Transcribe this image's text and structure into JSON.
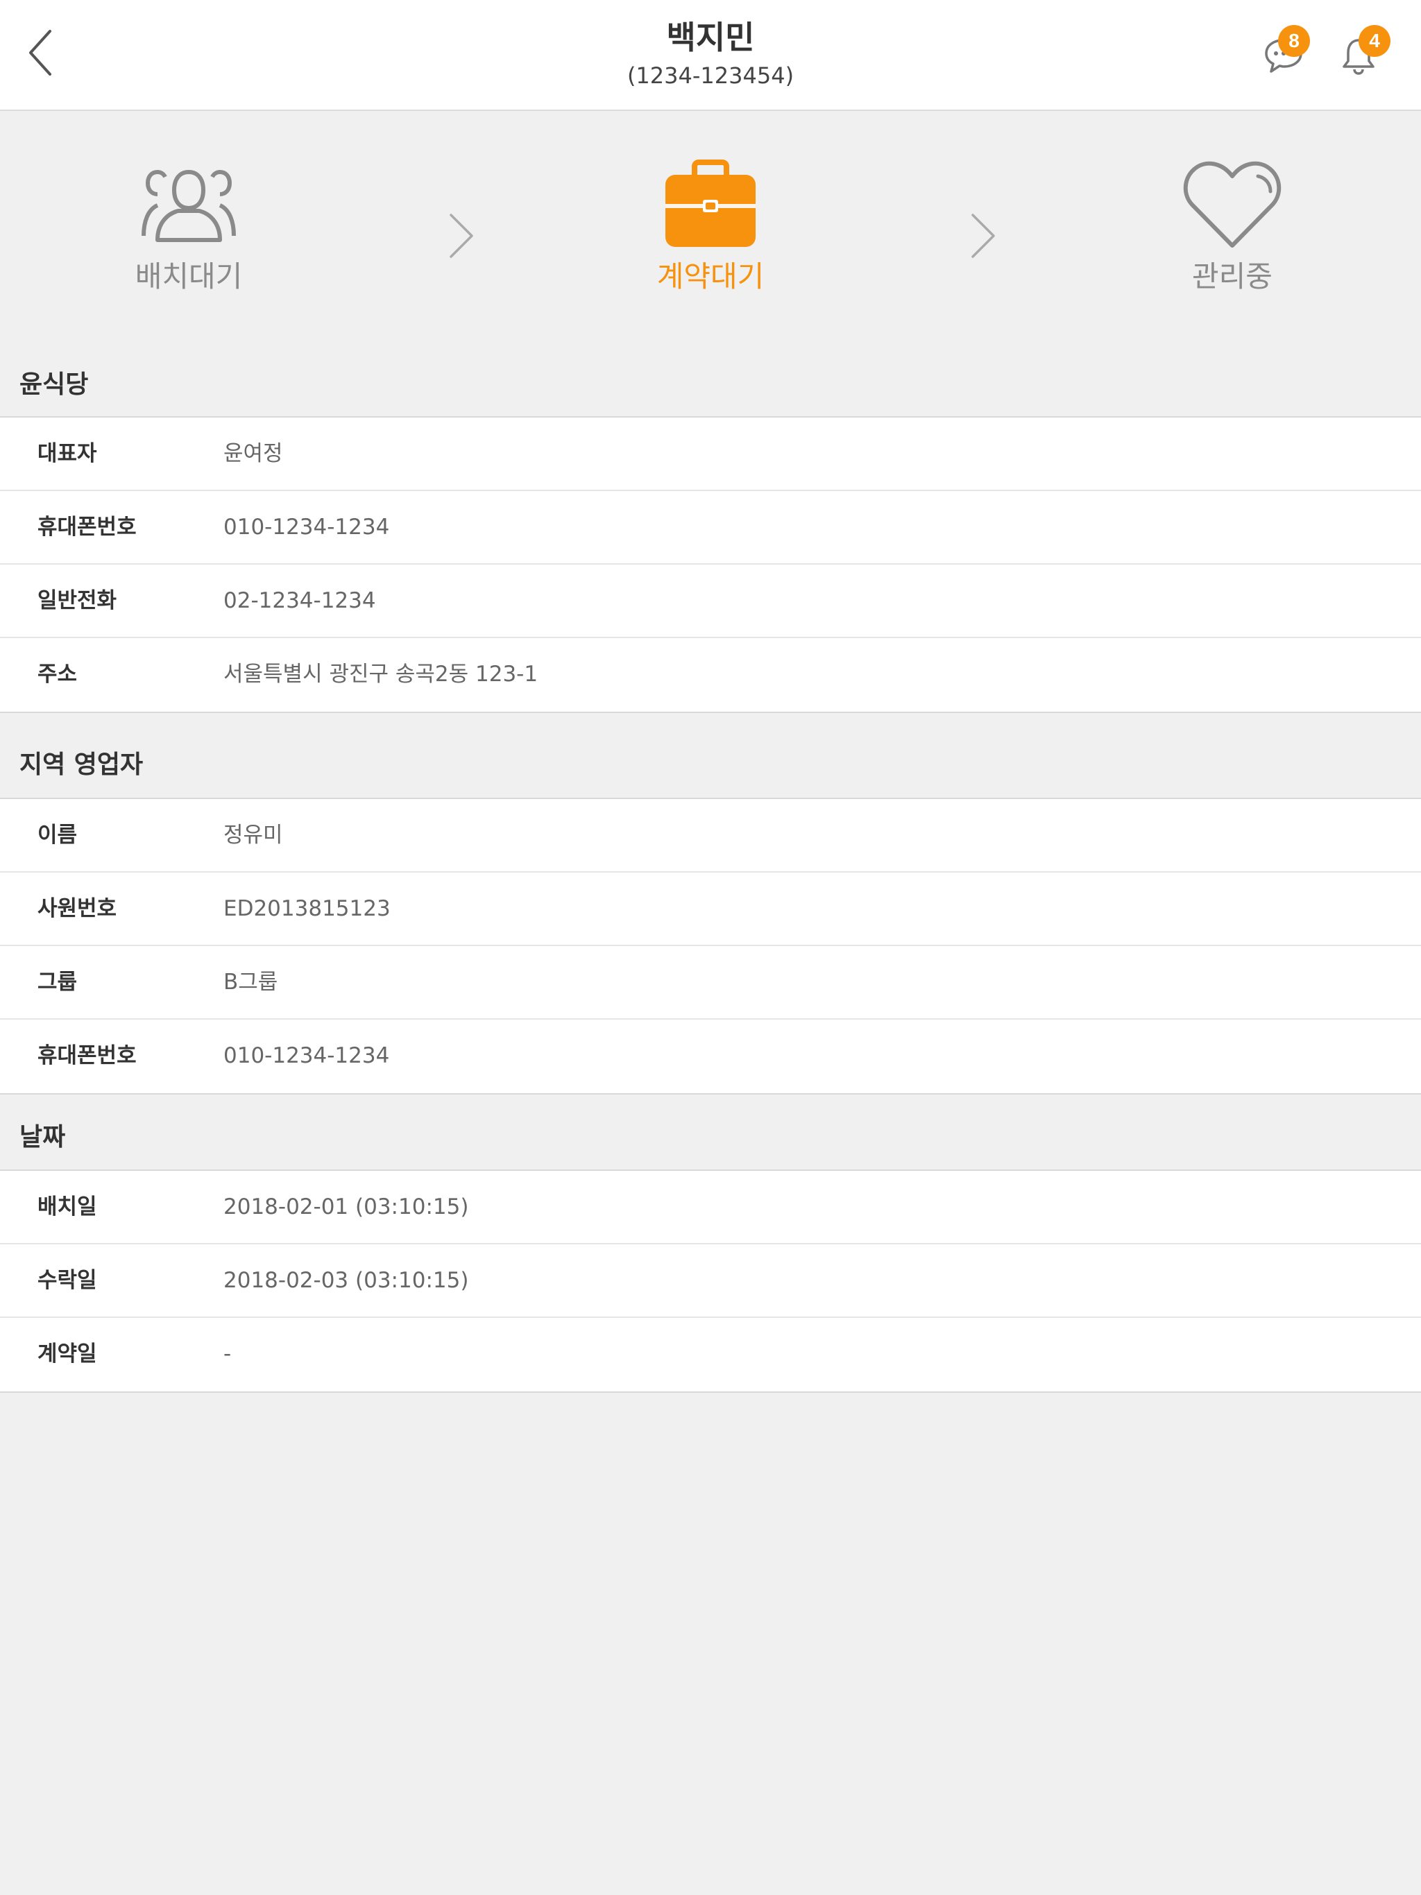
{
  "header": {
    "title": "백지민",
    "subtitle": "(1234-123454)",
    "chat_badge": "8",
    "bell_badge": "4"
  },
  "steps": [
    {
      "label": "배치대기",
      "icon": "users-icon",
      "active": false
    },
    {
      "label": "계약대기",
      "icon": "briefcase-icon",
      "active": true
    },
    {
      "label": "관리중",
      "icon": "heart-icon",
      "active": false
    }
  ],
  "colors": {
    "accent": "#f7920f",
    "inactive": "#8a8a8a"
  },
  "sections": {
    "store": {
      "title": "윤식당",
      "rows": [
        {
          "label": "대표자",
          "value": "윤여정"
        },
        {
          "label": "휴대폰번호",
          "value": "010-1234-1234"
        },
        {
          "label": "일반전화",
          "value": "02-1234-1234"
        },
        {
          "label": "주소",
          "value": "서울특별시 광진구 송곡2동 123-1"
        }
      ]
    },
    "sales": {
      "title": "지역 영업자",
      "rows": [
        {
          "label": "이름",
          "value": "정유미"
        },
        {
          "label": "사원번호",
          "value": "ED2013815123"
        },
        {
          "label": "그룹",
          "value": "B그룹"
        },
        {
          "label": "휴대폰번호",
          "value": "010-1234-1234"
        }
      ]
    },
    "dates": {
      "title": "날짜",
      "rows": [
        {
          "label": "배치일",
          "value": "2018-02-01 (03:10:15)"
        },
        {
          "label": "수락일",
          "value": "2018-02-03 (03:10:15)"
        },
        {
          "label": "계약일",
          "value": "-"
        }
      ]
    }
  }
}
